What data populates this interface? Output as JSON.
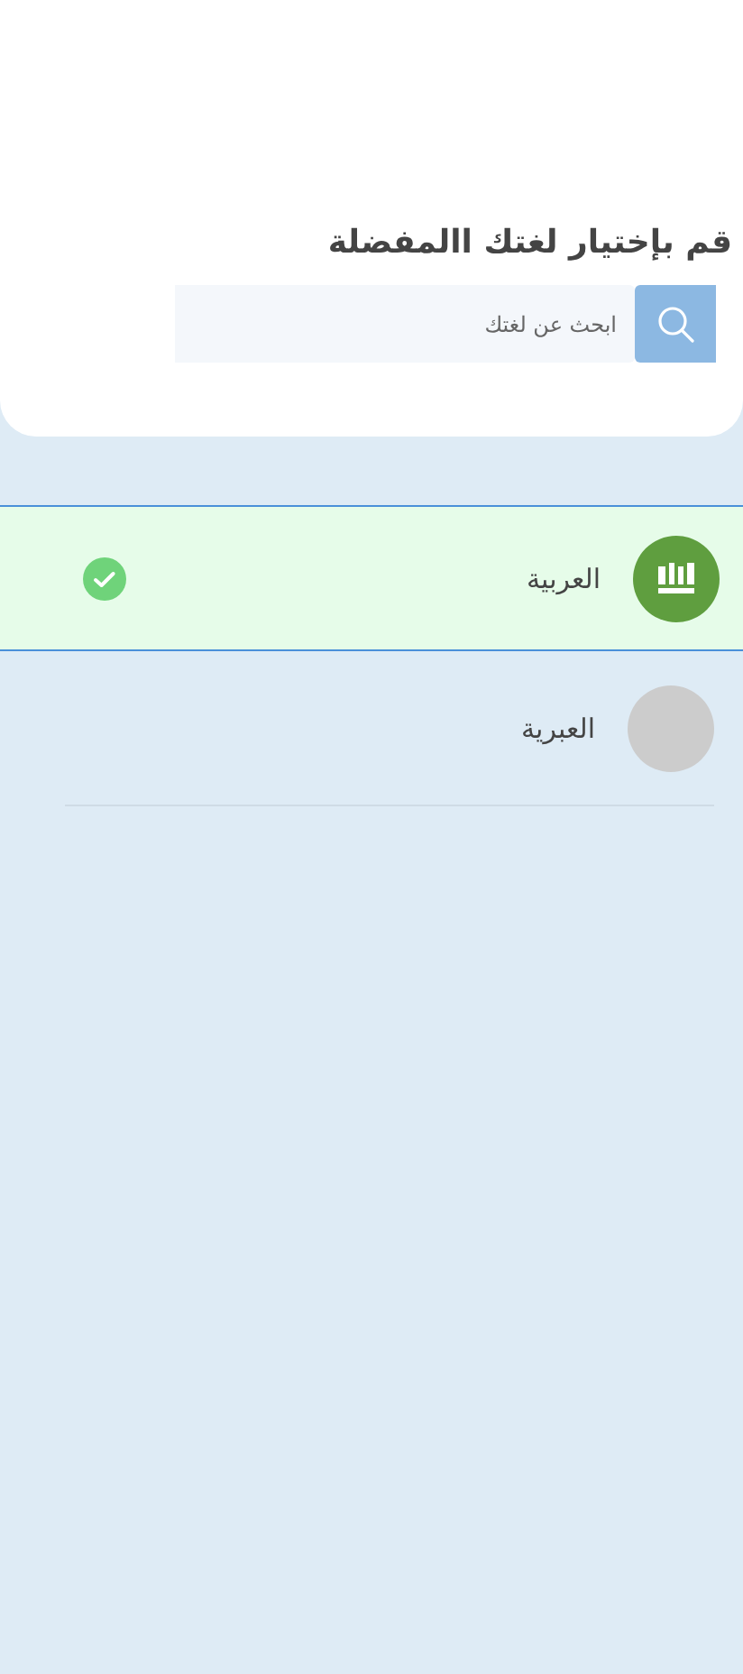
{
  "header": {
    "title": "قم بإختيار لغتك االمفضلة"
  },
  "search": {
    "placeholder": "ابحث عن لغتك"
  },
  "languages": [
    {
      "name": "العربية",
      "kind": "flag",
      "selected": true
    },
    {
      "name": "العبرية",
      "kind": "placeholder",
      "selected": false
    }
  ]
}
